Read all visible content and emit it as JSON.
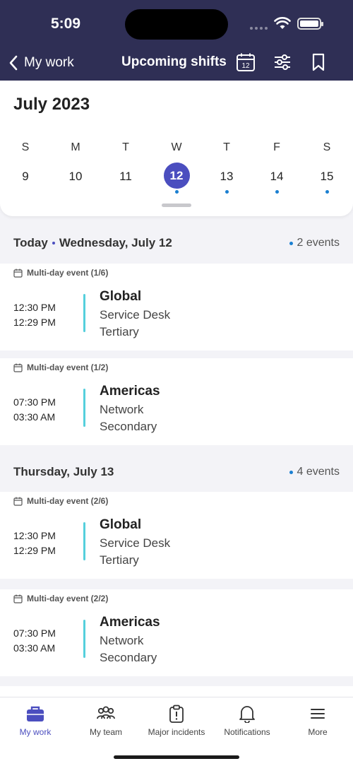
{
  "status_bar": {
    "time": "5:09"
  },
  "nav": {
    "back_label": "My work",
    "title": "Upcoming shifts",
    "calendar_icon_day": "12"
  },
  "calendar": {
    "month_label": "July 2023",
    "weekdays": [
      "S",
      "M",
      "T",
      "W",
      "T",
      "F",
      "S"
    ],
    "days": [
      "9",
      "10",
      "11",
      "12",
      "13",
      "14",
      "15"
    ],
    "selected_day": "12",
    "accent": "#4b4ebf"
  },
  "sections": [
    {
      "prefix": "Today",
      "date": "Wednesday, July 12",
      "count_label": "2 events",
      "events": [
        {
          "meta": "Multi-day event (1/6)",
          "start": "12:30 PM",
          "end": "12:29 PM",
          "title": "Global",
          "line1": "Service Desk",
          "line2": "Tertiary"
        },
        {
          "meta": "Multi-day event (1/2)",
          "start": "07:30 PM",
          "end": "03:30 AM",
          "title": "Americas",
          "line1": "Network",
          "line2": "Secondary"
        }
      ]
    },
    {
      "prefix": "",
      "date": "Thursday, July 13",
      "count_label": "4 events",
      "events": [
        {
          "meta": "Multi-day event (2/6)",
          "start": "12:30 PM",
          "end": "12:29 PM",
          "title": "Global",
          "line1": "Service Desk",
          "line2": "Tertiary"
        },
        {
          "meta": "Multi-day event (2/2)",
          "start": "07:30 PM",
          "end": "03:30 AM",
          "title": "Americas",
          "line1": "Network",
          "line2": "Secondary"
        }
      ]
    }
  ],
  "bottom_nav": {
    "items": [
      {
        "label": "My work",
        "icon": "briefcase-icon"
      },
      {
        "label": "My team",
        "icon": "team-icon"
      },
      {
        "label": "Major incidents",
        "icon": "clipboard-alert-icon"
      },
      {
        "label": "Notifications",
        "icon": "bell-icon"
      },
      {
        "label": "More",
        "icon": "menu-icon"
      }
    ]
  },
  "colors": {
    "header_bg": "#2f2f55",
    "shift_bar": "#55cfdc",
    "dot": "#1a7fd1"
  }
}
